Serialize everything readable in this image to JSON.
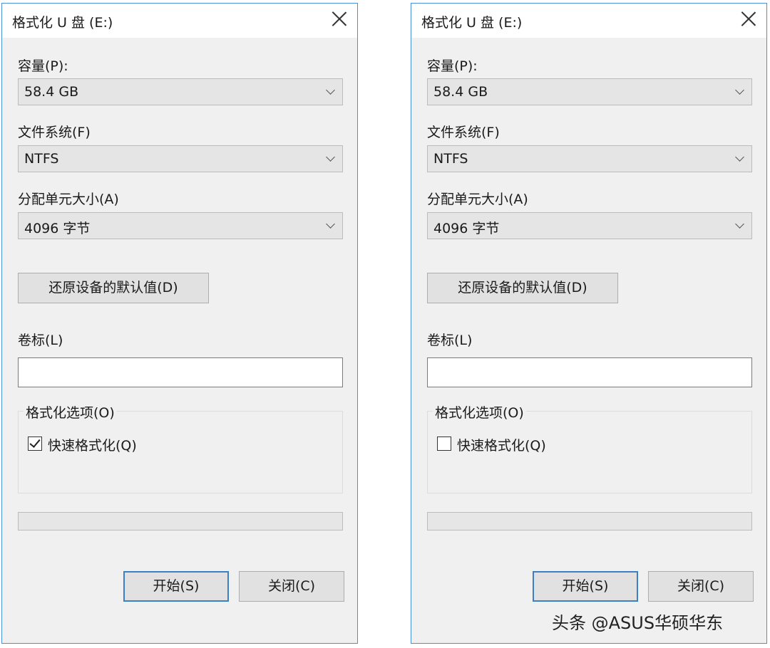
{
  "dialogs": [
    {
      "title": "格式化 U 盘 (E:)",
      "capacity_label": "容量(P):",
      "capacity_value": "58.4 GB",
      "filesystem_label": "文件系统(F)",
      "filesystem_value": "NTFS",
      "allocation_label": "分配单元大小(A)",
      "allocation_value": "4096 字节",
      "restore_defaults_label": "还原设备的默认值(D)",
      "volume_label_label": "卷标(L)",
      "volume_label_value": "",
      "format_options_label": "格式化选项(O)",
      "quick_format_label": "快速格式化(Q)",
      "quick_format_checked": true,
      "progress": 0,
      "start_label": "开始(S)",
      "close_label": "关闭(C)"
    },
    {
      "title": "格式化 U 盘 (E:)",
      "capacity_label": "容量(P):",
      "capacity_value": "58.4 GB",
      "filesystem_label": "文件系统(F)",
      "filesystem_value": "NTFS",
      "allocation_label": "分配单元大小(A)",
      "allocation_value": "4096 字节",
      "restore_defaults_label": "还原设备的默认值(D)",
      "volume_label_label": "卷标(L)",
      "volume_label_value": "",
      "format_options_label": "格式化选项(O)",
      "quick_format_label": "快速格式化(Q)",
      "quick_format_checked": false,
      "progress": 0,
      "start_label": "开始(S)",
      "close_label": "关闭(C)"
    }
  ],
  "watermark": "头条 @ASUS华硕华东",
  "colors": {
    "dialog_border": "#4a90d9",
    "primary_button_border": "#3c7fc4",
    "dialog_bg": "#f0f0f0"
  }
}
